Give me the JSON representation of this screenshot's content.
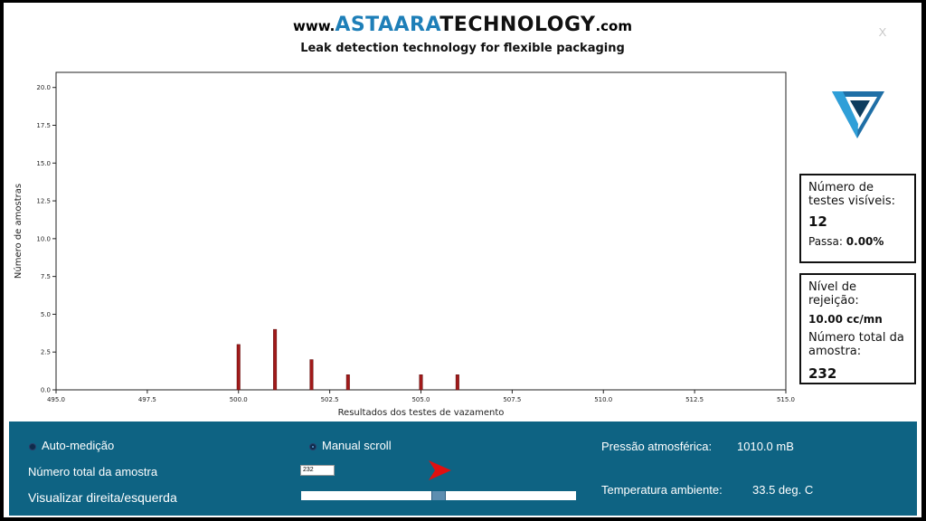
{
  "header": {
    "www": "www.",
    "brand_astaara": "ASTAARA",
    "brand_technology": "TECHNOLOGY",
    "domain_suffix": ".com",
    "tagline": "Leak detection technology for flexible packaging",
    "close_label": "X"
  },
  "chart_data": {
    "type": "bar",
    "xlabel": "Resultados dos testes de vazamento",
    "ylabel": "Número de amostras",
    "xlim": [
      495.0,
      515.0
    ],
    "ylim": [
      0.0,
      21.0
    ],
    "x_ticks": [
      "495.0",
      "497.5",
      "500.0",
      "502.5",
      "505.0",
      "507.5",
      "510.0",
      "512.5",
      "515.0"
    ],
    "y_ticks": [
      "0.0",
      "2.5",
      "5.0",
      "7.5",
      "10.0",
      "12.5",
      "15.0",
      "17.5",
      "20.0"
    ],
    "bar_color": "#a11a1a",
    "x": [
      500,
      501,
      502,
      503,
      505,
      506
    ],
    "values": [
      3,
      4,
      2,
      1,
      1,
      1
    ]
  },
  "info": {
    "visible_tests_label": "Número de testes visíveis:",
    "visible_tests_value": "12",
    "pass_label": "Passa:",
    "pass_value": "0.00%",
    "reject_label": "Nível de rejeição:",
    "reject_value": "10.00 cc/mn",
    "total_label": "Número total da amostra:",
    "total_value": "232"
  },
  "controls": {
    "auto_label": "Auto-medição",
    "manual_label": "Manual scroll",
    "selected_mode": "Manual scroll",
    "total_sample_label": "Número total da amostra",
    "total_sample_value": "232",
    "view_label": "Visualizar direita/esquerda",
    "slider_position": 0.5,
    "pressure_label": "Pressão atmosférica:",
    "pressure_value": "1010.0 mB",
    "temp_label": "Temperatura ambiente:",
    "temp_value": "33.5 deg. C"
  },
  "colors": {
    "panel_bg": "#0e6383",
    "brand_blue": "#1e7fb8",
    "bar": "#a11a1a",
    "arrow": "#e01010"
  },
  "icons": {
    "logo": "triangle-logo-icon",
    "next": "arrow-right-icon",
    "close": "close-icon"
  }
}
